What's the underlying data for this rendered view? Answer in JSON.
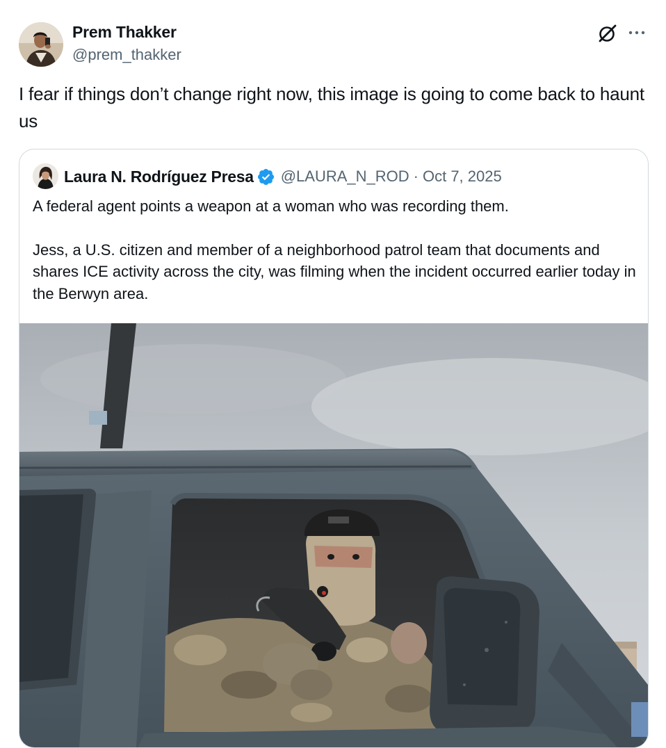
{
  "post": {
    "author_name": "Prem Thakker",
    "author_handle": "@prem_thakker",
    "text": "I fear if things don’t change right now, this image is going to come back to haunt us"
  },
  "icons": {
    "grok": "grok-icon",
    "more": "more-icon",
    "verified": "verified-badge-icon"
  },
  "quote": {
    "author_name": "Laura N. Rodríguez Presa",
    "author_handle": "@LAURA_N_ROD",
    "separator": "·",
    "date": "Oct 7, 2025",
    "text_paragraphs": [
      "A federal agent points a weapon at a woman who was recording them.",
      "Jess, a U.S. citizen and member of a neighborhood patrol team that documents and shares ICE activity across the city, was filming when the incident occurred earlier today in the Berwyn area."
    ]
  },
  "colors": {
    "text_primary": "#0f1419",
    "text_secondary": "#536471",
    "border": "#cfd9de",
    "verified_blue": "#1d9bf0"
  }
}
